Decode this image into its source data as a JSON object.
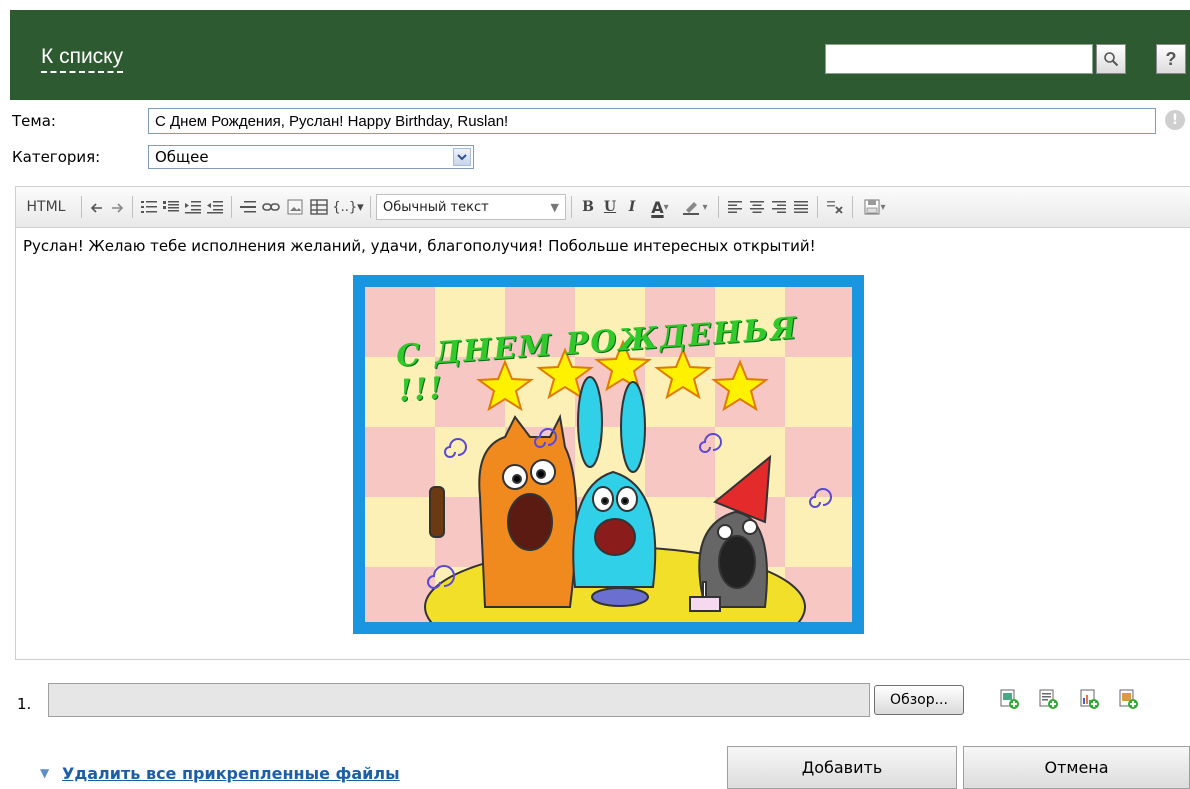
{
  "header": {
    "back_label": "К списку",
    "search_placeholder": "",
    "help_label": "?"
  },
  "form": {
    "subject_label": "Тема:",
    "subject_value": "С Днем Рождения, Руслан! Happy Birthday, Ruslan!",
    "category_label": "Категория:",
    "category_value": "Общее"
  },
  "toolbar": {
    "html_label": "HTML",
    "style_value": "Обычный текст",
    "bold": "B",
    "underline": "U",
    "italic": "I",
    "font_color": "A"
  },
  "editor": {
    "body_text": "Руслан! Желаю тебе исполнения желаний, удачи, благополучия! Побольше интересных открытий!",
    "card_title": "С ДНЕМ РОЖДЕНЬЯ !!!"
  },
  "attachments": {
    "row_number": "1.",
    "browse_label": "Обзор...",
    "remove_all_label": "Удалить все прикрепленные файлы"
  },
  "actions": {
    "add_label": "Добавить",
    "cancel_label": "Отмена"
  },
  "colors": {
    "header_bg": "#2e5a31",
    "link": "#1c5fa8",
    "card_frame": "#1a96e0"
  }
}
